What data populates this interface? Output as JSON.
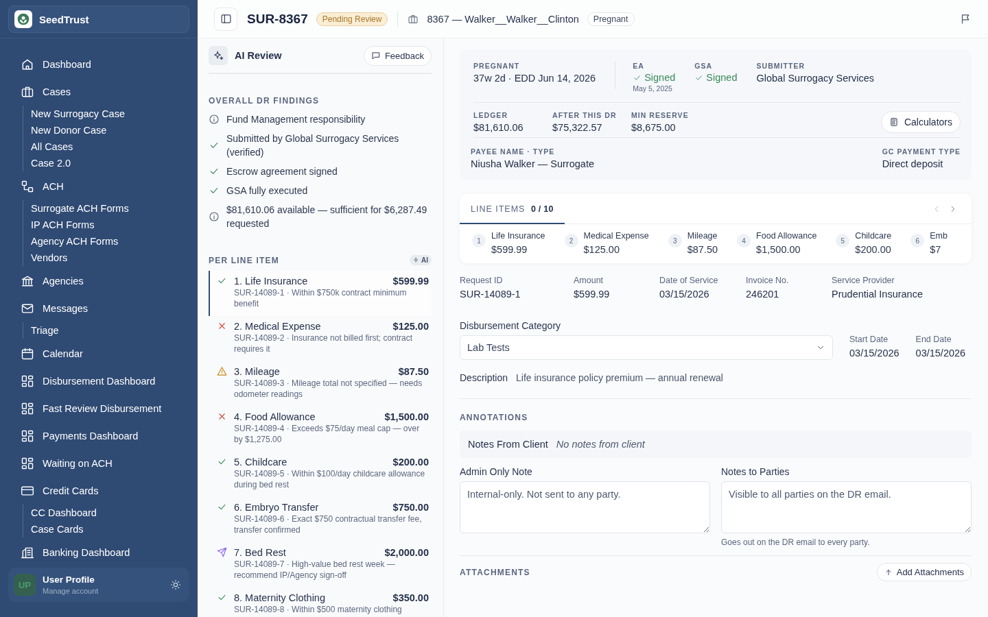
{
  "brand": {
    "name": "SeedTrust"
  },
  "nav": [
    {
      "label": "Dashboard",
      "kind": "home"
    },
    {
      "label": "Cases",
      "kind": "briefcase",
      "children": [
        "New Surrogacy Case",
        "New Donor Case",
        "All Cases",
        "Case 2.0"
      ]
    },
    {
      "label": "ACH",
      "kind": "ach",
      "children": [
        "Surrogate ACH Forms",
        "IP ACH Forms",
        "Agency ACH Forms",
        "Vendors"
      ]
    },
    {
      "label": "Agencies",
      "kind": "bank"
    },
    {
      "label": "Messages",
      "kind": "mail",
      "children": [
        "Triage"
      ]
    },
    {
      "label": "Calendar",
      "kind": "calendar"
    },
    {
      "label": "Disbursement Dashboard",
      "kind": "grid"
    },
    {
      "label": "Fast Review Disbursement",
      "kind": "grid"
    },
    {
      "label": "Payments Dashboard",
      "kind": "grid"
    },
    {
      "label": "Waiting on ACH",
      "kind": "grid"
    },
    {
      "label": "Credit Cards",
      "kind": "card",
      "children": [
        "CC Dashboard",
        "Case Cards"
      ]
    },
    {
      "label": "Banking Dashboard",
      "kind": "building"
    }
  ],
  "user": {
    "initials": "UP",
    "name": "User Profile",
    "subtitle": "Manage account"
  },
  "header": {
    "case_id": "SUR-8367",
    "status": "Pending Review",
    "case_name": "8367 — Walker__Walker__Clinton",
    "stage": "Pregnant"
  },
  "ai_review": {
    "title": "AI Review",
    "feedback_button": "Feedback",
    "findings_heading": "OVERALL DR FINDINGS",
    "findings": [
      {
        "kind": "info",
        "text": "Fund Management responsibility"
      },
      {
        "kind": "ok",
        "text": "Submitted by Global Surrogacy Services (verified)"
      },
      {
        "kind": "ok",
        "text": "Escrow agreement signed"
      },
      {
        "kind": "ok",
        "text": "GSA fully executed"
      },
      {
        "kind": "info",
        "text": "$81,610.06 available — sufficient for $6,287.49 requested"
      }
    ],
    "per_item_heading": "PER LINE ITEM",
    "ai_badge": "AI",
    "items": [
      {
        "kind": "ok",
        "selected": true,
        "title": "1. Life Insurance",
        "amount": "$599.99",
        "note": "SUR-14089-1 · Within $750k contract minimum benefit"
      },
      {
        "kind": "error",
        "selected": false,
        "title": "2. Medical Expense",
        "amount": "$125.00",
        "note": "SUR-14089-2 · Insurance not billed first; contract requires it"
      },
      {
        "kind": "warning",
        "selected": false,
        "title": "3. Mileage",
        "amount": "$87.50",
        "note": "SUR-14089-3 · Mileage total not specified — needs odometer readings"
      },
      {
        "kind": "error",
        "selected": false,
        "title": "4. Food Allowance",
        "amount": "$1,500.00",
        "note": "SUR-14089-4 · Exceeds $75/day meal cap — over by $1,275.00"
      },
      {
        "kind": "ok",
        "selected": false,
        "title": "5. Childcare",
        "amount": "$200.00",
        "note": "SUR-14089-5 · Within $100/day childcare allowance during bed rest"
      },
      {
        "kind": "ok",
        "selected": false,
        "title": "6. Embryo Transfer",
        "amount": "$750.00",
        "note": "SUR-14089-6 · Exact $750 contractual transfer fee, transfer confirmed"
      },
      {
        "kind": "send",
        "selected": false,
        "title": "7. Bed Rest",
        "amount": "$2,000.00",
        "note": "SUR-14089-7 · High-value bed rest week — recommend IP/Agency sign-off"
      },
      {
        "kind": "ok",
        "selected": false,
        "title": "8. Maternity Clothing",
        "amount": "$350.00",
        "note": "SUR-14089-8 · Within $500 maternity clothing"
      }
    ]
  },
  "summary": {
    "pregnancy": {
      "label": "PREGNANT",
      "value": "37w 2d · EDD Jun 14, 2026"
    },
    "signatures": [
      {
        "label": "EA",
        "status": "Signed",
        "signed": true,
        "date": "May 5, 2025"
      },
      {
        "label": "GSA",
        "status": "Signed",
        "signed": true
      }
    ],
    "submitter": {
      "label": "SUBMITTER",
      "value": "Global Surrogacy Services"
    },
    "amounts": [
      {
        "label": "LEDGER",
        "value": "$81,610.06"
      },
      {
        "label": "AFTER THIS DR",
        "value": "$75,322.57"
      },
      {
        "label": "MIN RESERVE",
        "value": "$8,675.00"
      }
    ],
    "calculators_button": "Calculators",
    "payee": {
      "label": "PAYEE NAME · TYPE",
      "value": "Niusha Walker — Surrogate"
    },
    "payment_type": {
      "label": "GC PAYMENT TYPE",
      "value": "Direct deposit"
    }
  },
  "line_items": {
    "tab_label": "LINE ITEMS **0 / 10**",
    "tabs": [
      {
        "number": "1",
        "name": "Life Insurance",
        "amount": "$599.99"
      },
      {
        "number": "2",
        "name": "Medical Expense",
        "amount": "$125.00"
      },
      {
        "number": "3",
        "name": "Mileage",
        "amount": "$87.50"
      },
      {
        "number": "4",
        "name": "Food Allowance",
        "amount": "$1,500.00"
      },
      {
        "number": "5",
        "name": "Childcare",
        "amount": "$200.00"
      },
      {
        "number": "6",
        "name": "Emb",
        "amount": "$7"
      }
    ]
  },
  "detail": {
    "fields": [
      {
        "label": "Request ID",
        "value": "SUR-14089-1"
      },
      {
        "label": "Amount",
        "value": "$599.99"
      },
      {
        "label": "Date of Service",
        "value": "03/15/2026"
      },
      {
        "label": "Invoice No.",
        "value": "246201"
      },
      {
        "label": "Service Provider",
        "value": "Prudential Insurance"
      }
    ],
    "category": {
      "label": "Disbursement Category",
      "value": "Lab Tests"
    },
    "dates": [
      {
        "label": "Start Date",
        "value": "03/15/2026"
      },
      {
        "label": "End Date",
        "value": "03/15/2026"
      }
    ],
    "description": {
      "label": "Description",
      "value": "Life insurance policy premium — annual renewal"
    }
  },
  "annotations": {
    "heading": "ANNOTATIONS",
    "client_note": {
      "label": "Notes From Client",
      "value": "No notes from client"
    },
    "admin_note": {
      "label": "Admin Only Note",
      "placeholder": "Internal-only. Not sent to any party."
    },
    "parties_note": {
      "label": "Notes to Parties",
      "placeholder": "Visible to all parties on the DR email.",
      "hint": "Goes out on the DR email to every party."
    }
  },
  "attachments": {
    "heading": "ATTACHMENTS",
    "add_button": "Add Attachments"
  }
}
